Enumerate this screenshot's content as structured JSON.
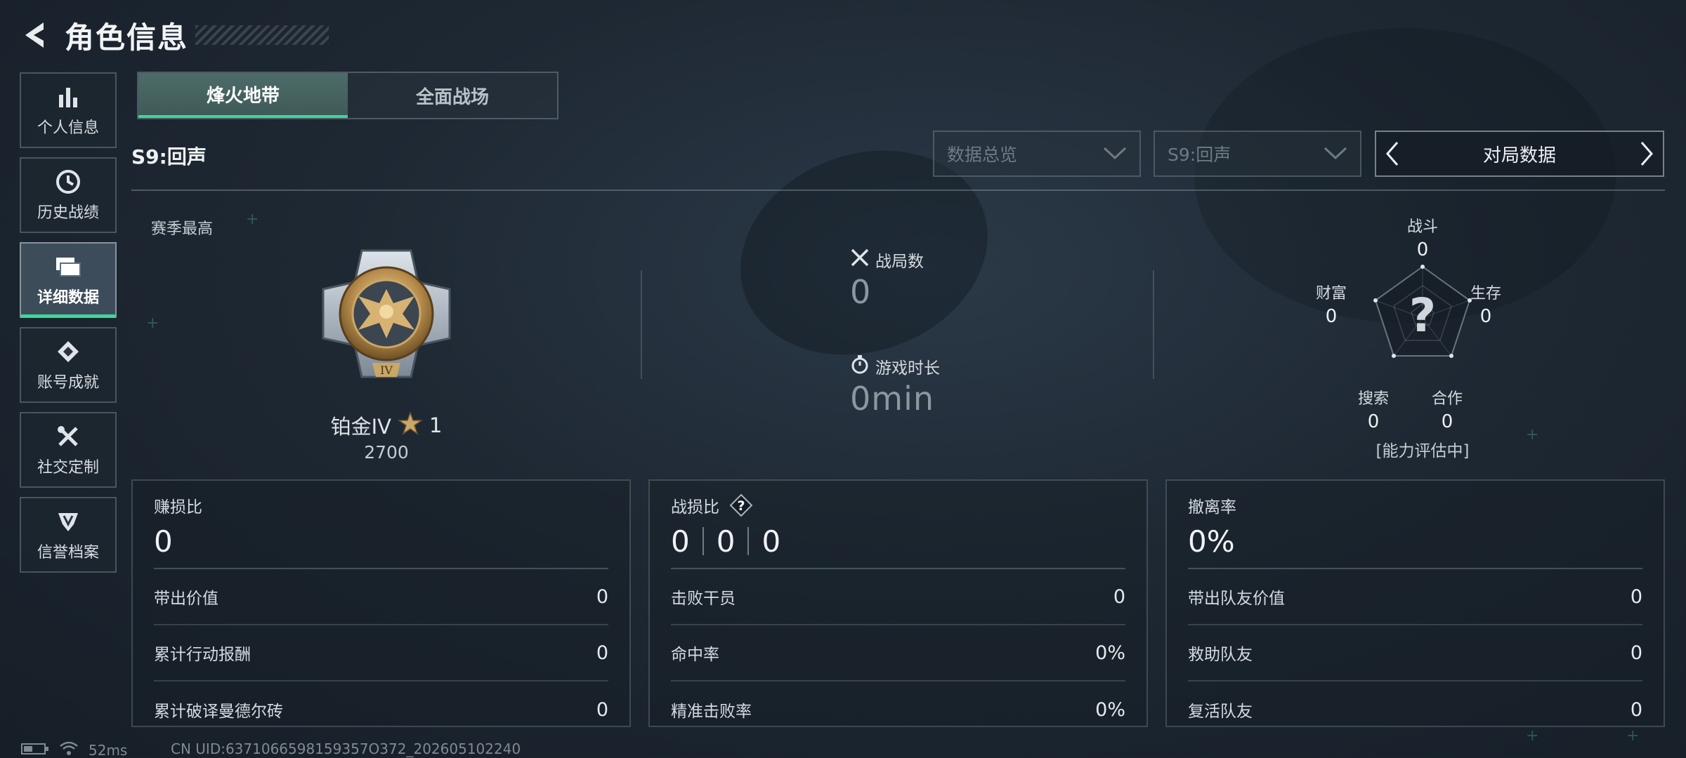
{
  "header": {
    "title": "角色信息"
  },
  "sidebar": {
    "items": [
      {
        "label": "个人信息",
        "icon": "bar-chart-icon"
      },
      {
        "label": "历史战绩",
        "icon": "clock-icon"
      },
      {
        "label": "详细数据",
        "icon": "folder-icon",
        "active": true
      },
      {
        "label": "账号成就",
        "icon": "badge-icon"
      },
      {
        "label": "社交定制",
        "icon": "tools-icon"
      },
      {
        "label": "信誉档案",
        "icon": "shield-icon"
      }
    ]
  },
  "tabs": [
    {
      "label": "烽火地带",
      "active": true
    },
    {
      "label": "全面战场",
      "active": false
    }
  ],
  "season": {
    "label": "S9:回声",
    "dropdown_overview": "数据总览",
    "dropdown_season": "S9:回声",
    "stepper_label": "对局数据"
  },
  "rank": {
    "season_best_label": "赛季最高",
    "tier": "铂金IV",
    "stars": "1",
    "score": "2700",
    "medal_numeral": "IV"
  },
  "battle": {
    "matches_label": "战局数",
    "matches_value": "0",
    "time_label": "游戏时长",
    "time_value": "0min"
  },
  "radar": {
    "center_mark": "?",
    "note": "[能力评估中]",
    "axes": [
      {
        "label": "战斗",
        "value": "0"
      },
      {
        "label": "生存",
        "value": "0"
      },
      {
        "label": "合作",
        "value": "0"
      },
      {
        "label": "搜索",
        "value": "0"
      },
      {
        "label": "财富",
        "value": "0"
      }
    ]
  },
  "panels": [
    {
      "title": "赚损比",
      "big": "0",
      "rows": [
        {
          "label": "带出价值",
          "value": "0"
        },
        {
          "label": "累计行动报酬",
          "value": "0"
        },
        {
          "label": "累计破译曼德尔砖",
          "value": "0"
        }
      ]
    },
    {
      "title": "战损比",
      "big_parts": [
        "0",
        "0",
        "0"
      ],
      "help": "?",
      "rows": [
        {
          "label": "击败干员",
          "value": "0"
        },
        {
          "label": "命中率",
          "value": "0%"
        },
        {
          "label": "精准击败率",
          "value": "0%"
        }
      ]
    },
    {
      "title": "撤离率",
      "big": "0%",
      "rows": [
        {
          "label": "带出队友价值",
          "value": "0"
        },
        {
          "label": "救助队友",
          "value": "0"
        },
        {
          "label": "复活队友",
          "value": "0"
        }
      ]
    }
  ],
  "status": {
    "ping": "52ms",
    "uid": "CN UID:6371066598159357O372_202605102240"
  },
  "colors": {
    "accent": "#3ed79a",
    "background": "#1e2833"
  }
}
